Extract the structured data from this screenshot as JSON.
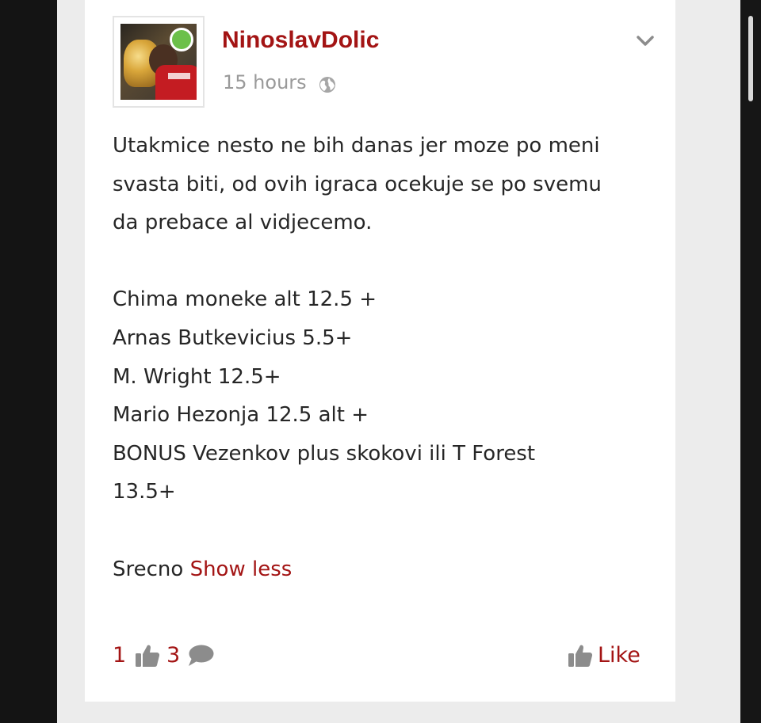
{
  "post": {
    "author": "NinoslavDolic",
    "timestamp": "15 hours",
    "body_lines": [
      "Utakmice nesto ne bih danas jer moze po meni",
      "svasta biti, od ovih igraca ocekuje se po svemu",
      "da prebace al vidjecemo.",
      "",
      "Chima moneke alt 12.5 +",
      "Arnas Butkevicius 5.5+",
      "M. Wright 12.5+",
      "Mario Hezonja 12.5 alt +",
      "BONUS Vezenkov plus skokovi ili T Forest",
      "13.5+",
      "",
      "Srecno"
    ],
    "show_less_label": "Show less",
    "likes_count": "1",
    "comments_count": "3",
    "like_label": "Like"
  },
  "icons": {
    "visibility": "globe-icon",
    "menu": "chevron-down-icon",
    "likes": "thumbs-up-icon",
    "comments": "speech-bubble-icon",
    "like_action": "thumbs-up-icon"
  },
  "colors": {
    "accent": "#a31414",
    "online": "#6cc04a",
    "text": "#262626",
    "muted": "#9a9a9a",
    "icon_gray": "#8c8c8c",
    "page_bg": "#ececec",
    "card_bg": "#ffffff",
    "frame": "#161616"
  }
}
